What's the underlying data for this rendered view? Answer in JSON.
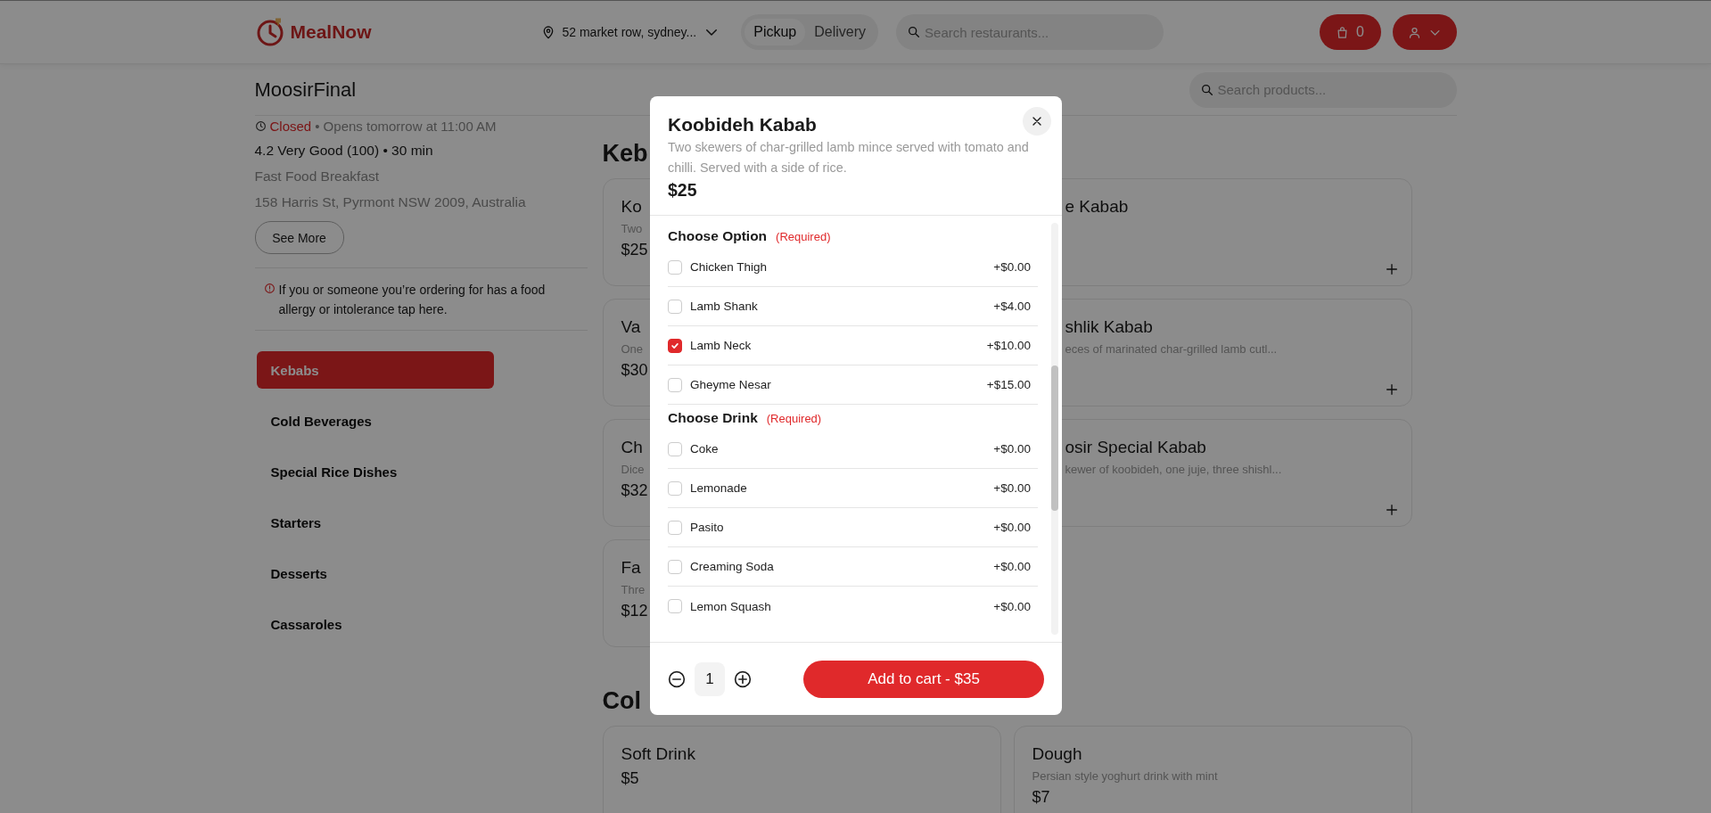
{
  "header": {
    "brand": "MealNow",
    "location": "52 market row, sydney...",
    "modes": [
      {
        "label": "Pickup",
        "selected": true
      },
      {
        "label": "Delivery",
        "selected": false
      }
    ],
    "search": {
      "placeholder": "Search restaurants..."
    },
    "cart_count": "0"
  },
  "restaurant": {
    "name": "MoosirFinal",
    "status": "Closed",
    "hours": "• Opens tomorrow at 11:00 AM",
    "rating": "4.2 Very Good (100) • 30 min",
    "cuisine": "Fast Food Breakfast",
    "address": "158 Harris St, Pyrmont NSW 2009, Australia",
    "see_more": "See More",
    "allergy_notice": "If you or someone you’re ordering for has a food allergy or intolerance tap here."
  },
  "product_search": {
    "placeholder": "Search products..."
  },
  "categories": [
    {
      "label": "Kebabs",
      "selected": true
    },
    {
      "label": "Cold Beverages",
      "selected": false
    },
    {
      "label": "Special Rice Dishes",
      "selected": false
    },
    {
      "label": "Starters",
      "selected": false
    },
    {
      "label": "Desserts",
      "selected": false
    },
    {
      "label": "Cassaroles",
      "selected": false
    }
  ],
  "sections": [
    {
      "heading": "Keb",
      "cards": [
        {
          "title": "Ko",
          "description": "Two",
          "price": "$25",
          "add_button": false
        },
        {
          "title": "e Kabab",
          "add_button": true
        },
        {
          "title": "Va",
          "description": "One",
          "price": "$30",
          "add_button": false
        },
        {
          "title": "shlik Kabab",
          "description": "eces of marinated char-grilled lamb cutl...",
          "add_button": true
        },
        {
          "title": "Ch",
          "description": "Dice",
          "price": "$32",
          "add_button": false
        },
        {
          "title": "osir Special Kabab",
          "description": "kewer of koobideh, one juje, three shishl...",
          "add_button": true
        },
        {
          "title": "Fa",
          "description": "Thre",
          "price": "$12",
          "add_button": false
        }
      ]
    },
    {
      "heading": "Col",
      "cards": [
        {
          "title": "Soft Drink",
          "price": "$5",
          "add_button": false
        },
        {
          "title": "Dough",
          "description": "Persian style yoghurt drink with mint",
          "price": "$7",
          "add_button": false
        }
      ]
    }
  ],
  "dialog": {
    "title": "Koobideh Kabab",
    "description": "Two skewers of char-grilled lamb mince served with tomato and chilli. Served with a side of rice.",
    "price": "$25",
    "groups": [
      {
        "heading": "Choose Option",
        "note": "(Required)",
        "options": [
          {
            "label": "Chicken Thigh",
            "price": "+$0.00",
            "checked": false
          },
          {
            "label": "Lamb Shank",
            "price": "+$4.00",
            "checked": false
          },
          {
            "label": "Lamb Neck",
            "price": "+$10.00",
            "checked": true
          },
          {
            "label": "Gheyme Nesar",
            "price": "+$15.00",
            "checked": false
          }
        ]
      },
      {
        "heading": "Choose Drink",
        "note": "(Required)",
        "options": [
          {
            "label": "Coke",
            "price": "+$0.00",
            "checked": false
          },
          {
            "label": "Lemonade",
            "price": "+$0.00",
            "checked": false
          },
          {
            "label": "Pasito",
            "price": "+$0.00",
            "checked": false
          },
          {
            "label": "Creaming Soda",
            "price": "+$0.00",
            "checked": false
          },
          {
            "label": "Lemon Squash",
            "price": "+$0.00",
            "checked": false
          }
        ]
      }
    ],
    "quantity": "1",
    "add_to_cart": "Add to cart - $35"
  }
}
